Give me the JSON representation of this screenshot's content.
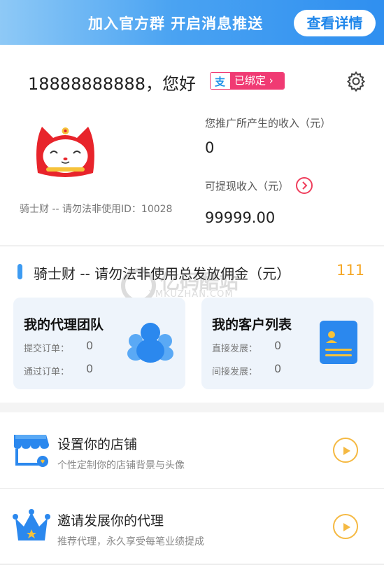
{
  "banner": {
    "text": "加入官方群 开启消息推送",
    "button_label": "查看详情"
  },
  "profile": {
    "phone_greeting": "18888888888，您好",
    "alipay_status": "已绑定",
    "user_name": "骑士财 -- 请勿法非使用ID：10028"
  },
  "income": {
    "label": "您推广所产生的收入（元）",
    "value": "0",
    "withdraw_label": "可提现收入（元）",
    "withdraw_value": "99999.00"
  },
  "commission": {
    "label": "骑士财 -- 请勿法非使用总发放佣金（元）",
    "value": "111"
  },
  "watermark": {
    "text": "亿码酷站",
    "url": "YMKUZHAN.COM"
  },
  "cards": {
    "team": {
      "title": "我的代理团队",
      "row1_label": "提交订单：",
      "row1_value": "0",
      "row2_label": "通过订单：",
      "row2_value": "0"
    },
    "customers": {
      "title": "我的客户列表",
      "row1_label": "直接发展：",
      "row1_value": "0",
      "row2_label": "间接发展：",
      "row2_value": "0"
    }
  },
  "menu": [
    {
      "title": "设置你的店铺",
      "subtitle": "个性定制你的店铺背景与头像",
      "icon": "shop-icon"
    },
    {
      "title": "邀请发展你的代理",
      "subtitle": "推荐代理，永久享受每笔业绩提成",
      "icon": "crown-icon"
    }
  ],
  "colors": {
    "accent_blue": "#3d9bf2",
    "alipay_pink": "#f03a73",
    "commission_orange": "#f5a623",
    "play_yellow": "#f5b942"
  }
}
